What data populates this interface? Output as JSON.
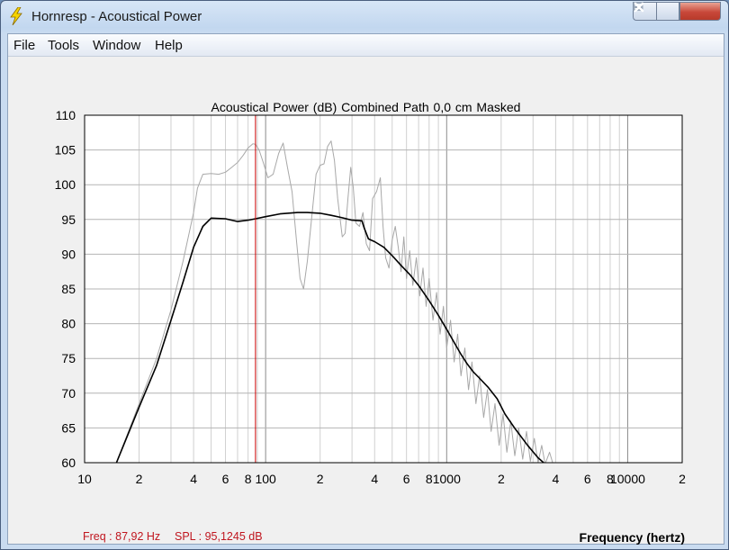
{
  "window": {
    "title": "Hornresp - Acoustical Power",
    "app_icon": "lightning-bolt-icon",
    "minimize_icon": "minimize-icon",
    "maximize_icon": "maximize-icon",
    "close_icon": "close-icon"
  },
  "menu": {
    "file": "File",
    "tools": "Tools",
    "window": "Window",
    "help": "Help"
  },
  "readout": {
    "freq": "Freq : 87,92 Hz",
    "spl": "SPL : 95,1245 dB"
  },
  "colors": {
    "cursor": "#cc0000",
    "combined": "#000000",
    "raw": "#a8a8a8",
    "grid": "#b4b4b4"
  },
  "chart_data": {
    "type": "line",
    "title": "Acoustical Power (dB)   Combined   Path 0,0 cm   Masked",
    "xlabel": "Frequency (hertz)",
    "ylabel": "",
    "x_scale": "log",
    "xlim": [
      10,
      20000
    ],
    "ylim": [
      60,
      110
    ],
    "y_ticks": [
      "110",
      "105",
      "100",
      "95",
      "90",
      "85",
      "80",
      "75",
      "70",
      "65",
      "60"
    ],
    "x_ticks": [
      {
        "value": 10,
        "label": "10"
      },
      {
        "value": 20,
        "label": "2"
      },
      {
        "value": 40,
        "label": "4"
      },
      {
        "value": 60,
        "label": "6"
      },
      {
        "value": 80,
        "label": "8"
      },
      {
        "value": 100,
        "label": "100"
      },
      {
        "value": 200,
        "label": "2"
      },
      {
        "value": 400,
        "label": "4"
      },
      {
        "value": 600,
        "label": "6"
      },
      {
        "value": 800,
        "label": "8"
      },
      {
        "value": 1000,
        "label": "1000"
      },
      {
        "value": 2000,
        "label": "2"
      },
      {
        "value": 4000,
        "label": "4"
      },
      {
        "value": 6000,
        "label": "6"
      },
      {
        "value": 8000,
        "label": "8"
      },
      {
        "value": 10000,
        "label": "10000"
      },
      {
        "value": 20000,
        "label": "2"
      }
    ],
    "major_x_lines": [
      100,
      1000,
      10000
    ],
    "grid": true,
    "cursor_x": 87.92,
    "series": [
      {
        "key": "combined",
        "x": [
          15,
          20,
          25,
          30,
          35,
          40,
          45,
          50,
          60,
          70,
          80,
          88,
          100,
          120,
          150,
          170,
          200,
          230,
          260,
          300,
          340,
          350,
          370,
          400,
          450,
          500,
          560,
          630,
          700,
          800,
          900,
          1000,
          1100,
          1200,
          1300,
          1400,
          1500,
          1700,
          1900,
          2100,
          2400,
          2800,
          3200,
          3800
        ],
        "values": [
          60,
          68,
          74,
          80.5,
          86,
          91,
          94,
          95.2,
          95.1,
          94.7,
          94.9,
          95.1,
          95.4,
          95.8,
          96.0,
          96.0,
          95.9,
          95.6,
          95.3,
          94.9,
          94.8,
          93.8,
          92.2,
          91.8,
          91.0,
          89.8,
          88.4,
          87.0,
          85.5,
          83.3,
          81.2,
          79.2,
          77.3,
          75.6,
          74.2,
          73.1,
          72.3,
          70.8,
          69.2,
          67.0,
          64.8,
          62.5,
          60.7,
          59.0
        ]
      },
      {
        "key": "raw",
        "x": [
          15,
          20,
          25,
          30,
          35,
          40,
          42,
          45,
          50,
          55,
          60,
          65,
          70,
          75,
          80,
          85,
          88,
          92,
          97,
          103,
          110,
          118,
          125,
          132,
          140,
          148,
          155,
          162,
          170,
          180,
          190,
          200,
          210,
          220,
          230,
          240,
          250,
          265,
          275,
          285,
          295,
          305,
          315,
          330,
          345,
          360,
          375,
          390,
          410,
          430,
          445,
          460,
          480,
          500,
          520,
          540,
          560,
          580,
          600,
          625,
          650,
          680,
          710,
          740,
          770,
          800,
          840,
          880,
          920,
          960,
          1000,
          1050,
          1100,
          1150,
          1200,
          1260,
          1320,
          1380,
          1450,
          1520,
          1600,
          1680,
          1760,
          1850,
          1950,
          2050,
          2150,
          2260,
          2380,
          2500,
          2630,
          2760,
          2900,
          3050,
          3200,
          3350,
          3500,
          3700,
          3900,
          4000
        ],
        "values": [
          60,
          68.5,
          75,
          82,
          89,
          96,
          99.5,
          101.5,
          101.6,
          101.5,
          101.8,
          102.5,
          103.2,
          104.2,
          105.3,
          105.9,
          105.8,
          105.0,
          103.2,
          101.0,
          101.5,
          104.5,
          106.0,
          102.5,
          99.0,
          92.0,
          86.5,
          85.0,
          89.0,
          95.5,
          101.5,
          102.8,
          103.0,
          105.5,
          106.3,
          103.5,
          98.0,
          92.5,
          93.0,
          98.0,
          102.5,
          99.5,
          94.5,
          94.0,
          96.0,
          91.5,
          90.5,
          98.0,
          99.0,
          101.0,
          94.0,
          89.5,
          88.0,
          92.0,
          94.0,
          91.0,
          87.5,
          92.5,
          86.5,
          90.5,
          85.5,
          89.5,
          84.0,
          88.0,
          82.5,
          86.5,
          80.5,
          84.5,
          78.5,
          82.5,
          76.5,
          80.5,
          74.5,
          78.5,
          72.5,
          76.5,
          70.5,
          74.5,
          68.5,
          72.5,
          66.5,
          70.5,
          64.5,
          68.5,
          62.5,
          67.0,
          61.5,
          66.0,
          61.0,
          65.0,
          60.5,
          64.5,
          60.2,
          63.5,
          60.0,
          62.5,
          59.8,
          61.5,
          59.5,
          59.0
        ]
      }
    ]
  }
}
